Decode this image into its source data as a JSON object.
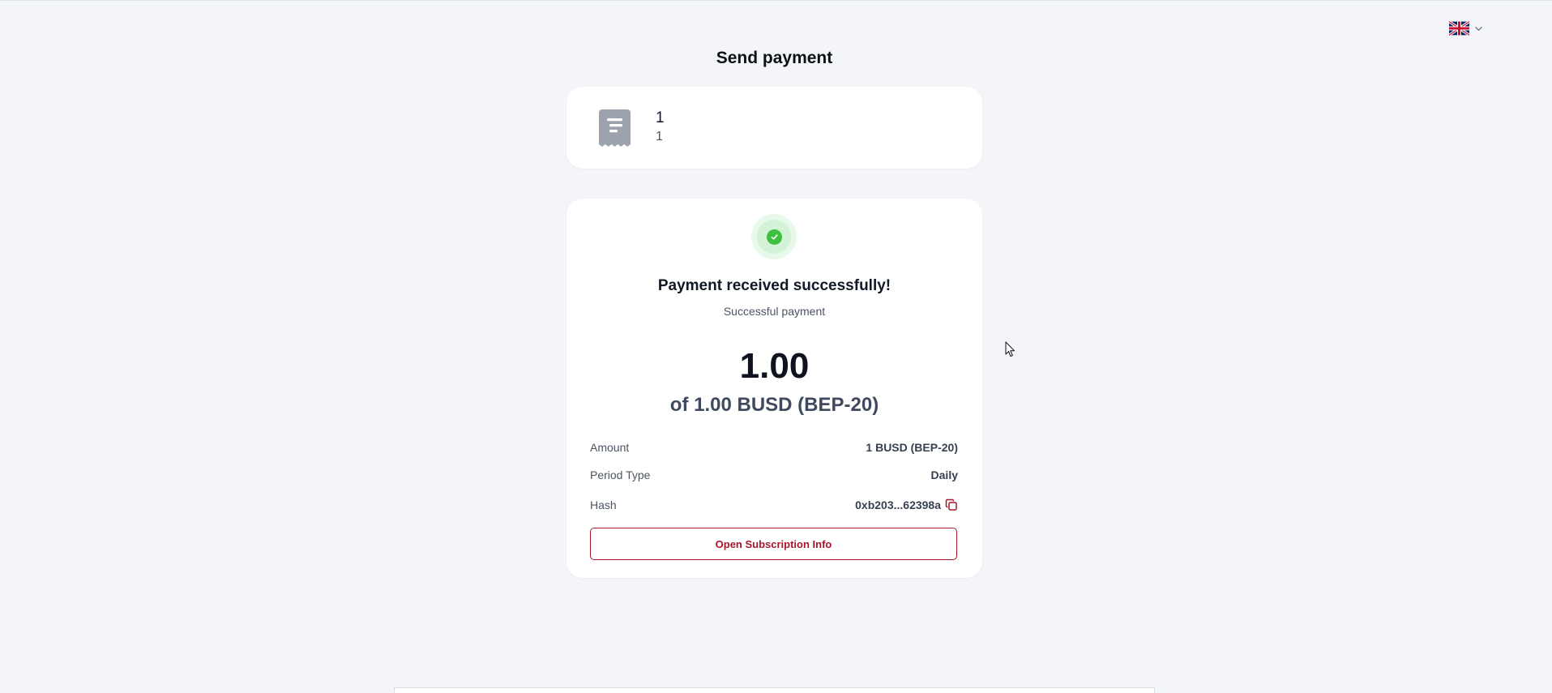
{
  "header": {
    "title": "Send payment",
    "language": {
      "flag_icon": "uk-flag-icon",
      "dropdown_icon": "chevron-down-icon"
    }
  },
  "invoice": {
    "icon": "receipt-icon",
    "title": "1",
    "description": "1"
  },
  "status": {
    "icon": "check-circle-icon",
    "title": "Payment received successfully!",
    "subtitle": "Successful payment",
    "amount_paid": "1.00",
    "amount_total": "of 1.00 BUSD (BEP-20)"
  },
  "details": {
    "amount": {
      "label": "Amount",
      "value": "1 BUSD (BEP-20)"
    },
    "period": {
      "label": "Period Type",
      "value": "Daily"
    },
    "hash": {
      "label": "Hash",
      "value": "0xb203...62398a",
      "copy_icon": "copy-icon"
    }
  },
  "actions": {
    "open_subscription_label": "Open Subscription Info"
  },
  "colors": {
    "background": "#f4f5f8",
    "card": "#ffffff",
    "accent": "#a7172a",
    "success": "#3fbf3f",
    "icon_gray": "#9ca3af"
  }
}
